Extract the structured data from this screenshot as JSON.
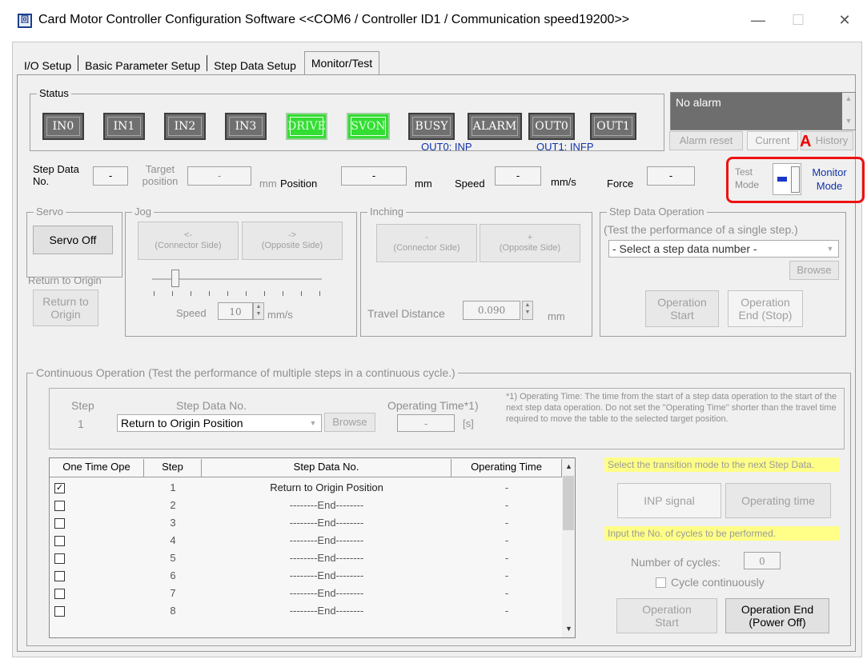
{
  "titlebar": {
    "icon_text": "回",
    "title": "Card Motor Controller Configuration Software <<COM6 / Controller ID1 / Communication speed19200>>",
    "minimize": "—",
    "maximize": "☐",
    "close": "✕"
  },
  "tabs": [
    "I/O Setup",
    "Basic Parameter Setup",
    "Step Data Setup",
    "Monitor/Test"
  ],
  "status": {
    "title": "Status",
    "indicators": [
      "IN0",
      "IN1",
      "IN2",
      "IN3",
      "DRIVE",
      "SVON",
      "BUSY",
      "ALARM",
      "OUT0",
      "OUT1"
    ],
    "active": [
      "DRIVE",
      "SVON"
    ],
    "out0_caption": "OUT0: INP",
    "out1_caption": "OUT1: INFP",
    "alarm_text": "No alarm",
    "alarm_reset": "Alarm reset",
    "current": "Current",
    "history": "History",
    "marker": "A"
  },
  "readouts": {
    "step_data_no_label": "Step Data No.",
    "step_data_no_value": "-",
    "target_label": "Target position",
    "target_value": "-",
    "target_unit": "mm",
    "position_label": "Position",
    "position_value": "-",
    "position_unit": "mm",
    "speed_label": "Speed",
    "speed_value": "-",
    "speed_unit": "mm/s",
    "force_label": "Force",
    "force_value": "-",
    "test_mode": "Test Mode",
    "monitor_mode": "Monitor Mode"
  },
  "servo": {
    "title": "Servo",
    "button": "Servo Off",
    "return_label": "Return to Origin",
    "return_button": "Return to Origin"
  },
  "jog": {
    "title": "Jog",
    "left_arrow": "<-",
    "left_label": "(Connector Side)",
    "right_arrow": "->",
    "right_label": "(Opposite Side)",
    "speed_label": "Speed",
    "speed_value": "10",
    "speed_unit": "mm/s"
  },
  "inching": {
    "title": "Inching",
    "minus": "-",
    "minus_label": "(Connector Side)",
    "plus": "+",
    "plus_label": "(Opposite Side)",
    "travel_label": "Travel Distance",
    "travel_value": "0.090",
    "travel_unit": "mm"
  },
  "step_op": {
    "title": "Step Data Operation",
    "subtitle": "(Test the performance of a single step.)",
    "select": "- Select a step data number -",
    "browse": "Browse",
    "start": "Operation Start",
    "end": "Operation End (Stop)"
  },
  "continuous": {
    "title": "Continuous Operation (Test the performance of multiple steps in a continuous cycle.)",
    "step_label": "Step",
    "step_value": "1",
    "step_data_label": "Step Data No.",
    "step_data_value": "Return to Origin Position",
    "browse": "Browse",
    "op_time_label": "Operating Time*1)",
    "op_time_value": "-",
    "op_time_unit": "[s]",
    "note": "*1) Operating Time: The time from the start of a step data operation to the start of the next step data operation. Do not set the \"Operating Time\" shorter than the travel time required to move the table to the selected target position.",
    "columns": [
      "One Time Ope",
      "Step",
      "Step Data No.",
      "Operating Time"
    ],
    "rows": [
      {
        "checked": "✓",
        "step": "1",
        "data": "Return to Origin Position",
        "time": "-"
      },
      {
        "checked": "",
        "step": "2",
        "data": "--------End--------",
        "time": "-"
      },
      {
        "checked": "",
        "step": "3",
        "data": "--------End--------",
        "time": "-"
      },
      {
        "checked": "",
        "step": "4",
        "data": "--------End--------",
        "time": "-"
      },
      {
        "checked": "",
        "step": "5",
        "data": "--------End--------",
        "time": "-"
      },
      {
        "checked": "",
        "step": "6",
        "data": "--------End--------",
        "time": "-"
      },
      {
        "checked": "",
        "step": "7",
        "data": "--------End--------",
        "time": "-"
      },
      {
        "checked": "",
        "step": "8",
        "data": "--------End--------",
        "time": "-"
      }
    ],
    "transition_note": "Select the transition mode to the next Step Data.",
    "inp_signal": "INP signal",
    "operating_time": "Operating time",
    "cycles_note": "Input the No. of cycles to be performed.",
    "cycles_label": "Number of cycles:",
    "cycles_value": "0",
    "cycle_continuous": "Cycle continuously",
    "op_start": "Operation Start",
    "op_end": "Operation End (Power Off)"
  }
}
